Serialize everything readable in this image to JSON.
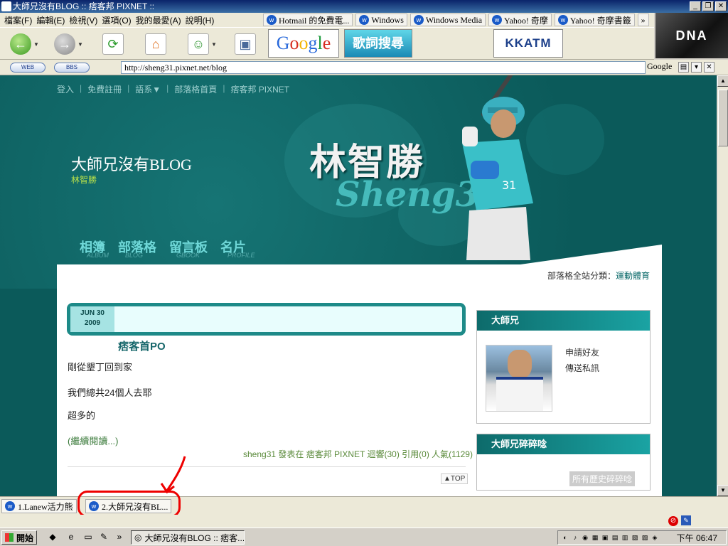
{
  "window": {
    "title": "大師兄沒有BLOG :: 痞客邦 PIXNET ::",
    "controls": [
      "_",
      "❐",
      "✕"
    ]
  },
  "menu": [
    "檔案(F)",
    "編輯(E)",
    "檢視(V)",
    "選項(O)",
    "我的最愛(A)",
    "說明(H)"
  ],
  "favorites": [
    {
      "icon": "w",
      "label": "Hotmail 的免費電..."
    },
    {
      "icon": "w",
      "label": "Windows"
    },
    {
      "icon": "w",
      "label": "Windows Media"
    },
    {
      "icon": "w",
      "label": "Yahoo! 奇摩"
    },
    {
      "icon": "w",
      "label": "Yahoo! 奇摩書籤"
    }
  ],
  "favorites_more": "»",
  "toolbar": {
    "back_icon": "back-arrow-icon",
    "forward_icon": "forward-arrow-icon",
    "refresh_icon": "refresh-icon",
    "home_icon": "home-icon",
    "google_label": "Google",
    "lyrics_label": "歌詞搜尋",
    "kkatm_label": "KKATM",
    "dna_label": "DNA"
  },
  "address": {
    "web_pill": "WEB",
    "bbs_pill": "BBS",
    "url": "http://sheng31.pixnet.net/blog",
    "search_brand": "Google"
  },
  "page": {
    "topnav": [
      "登入",
      "免費註冊",
      "語系▼",
      "部落格首頁",
      "痞客邦 PIXNET"
    ],
    "blog_title": "大師兄沒有BLOG",
    "blog_subtitle": "林智勝",
    "banner_name": "林智勝",
    "banner_script": "Sheng31",
    "nav_tabs": [
      {
        "label": "相簿",
        "en": "ALBUM"
      },
      {
        "label": "部落格",
        "en": "BLOG"
      },
      {
        "label": "留言板",
        "en": "GBOOK"
      },
      {
        "label": "名片",
        "en": "PROFILE"
      }
    ],
    "category_label": "部落格全站分類：",
    "category_value": "運動體育"
  },
  "post": {
    "date_month_day": "JUN 30",
    "date_year": "2009",
    "title": "痞客首PO",
    "lines": [
      "剛從墾丁回到家",
      "我們總共24個人去耶",
      "超多的"
    ],
    "read_more": "(繼續閱讀...)",
    "meta": "sheng31 發表在 痞客邦 PIXNET 迴響(30) 引用(0) 人氣(1129)",
    "top_label": "▲TOP"
  },
  "sidebar": {
    "profile_title": "大師兄",
    "profile_links": [
      "申請好友",
      "傳送私訊"
    ],
    "chatter_title": "大師兄碎碎唸",
    "chatter_button": "所有歷史碎碎唸"
  },
  "ie_tabs": [
    {
      "icon": "w",
      "label": "1.Lanew活力熊"
    },
    {
      "icon": "w",
      "label": "2.大師兄沒有BL..."
    }
  ],
  "taskbar": {
    "start_label": "開始",
    "task_label": "大師兄沒有BLOG :: 痞客...",
    "clock": "下午 06:47"
  },
  "colors": {
    "page_bg": "#0b5a5a",
    "accent": "#1d8a88",
    "highlight": "#e00000"
  }
}
